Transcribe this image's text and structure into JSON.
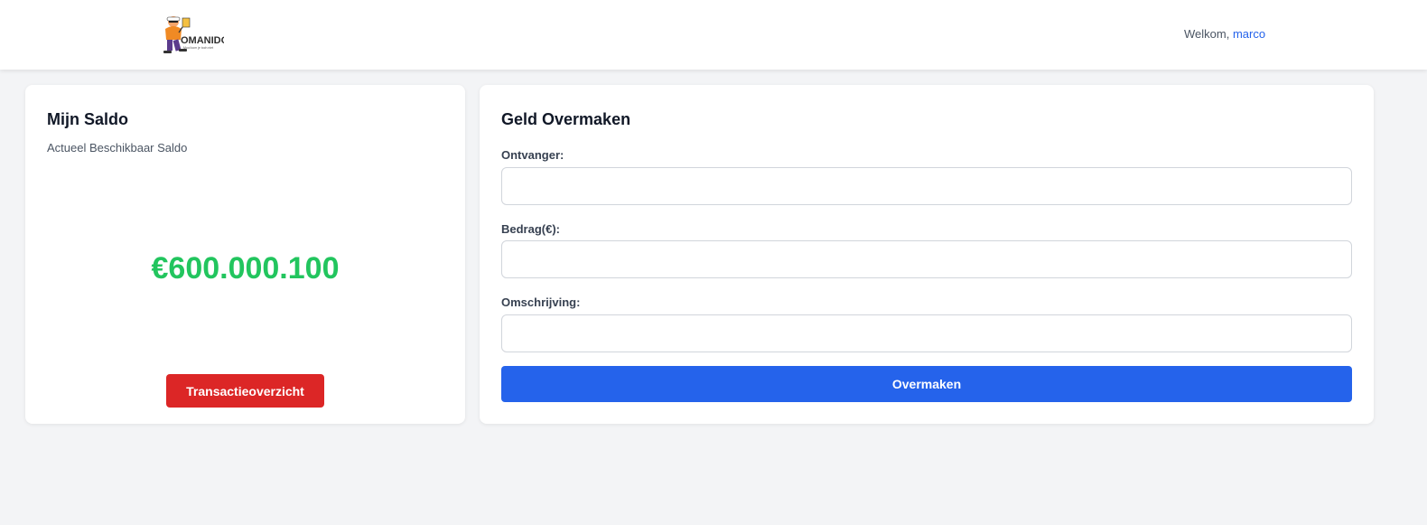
{
  "header": {
    "logo_text": "OMANIDO",
    "logo_tagline": "Mooi kom je toch niet",
    "welcome_text": "Welkom, ",
    "username": "marco"
  },
  "balance_card": {
    "title": "Mijn Saldo",
    "subtitle": "Actueel Beschikbaar Saldo",
    "amount": "€600.000.100",
    "amount_color": "#22c55e",
    "button_label": "Transactieoverzicht",
    "button_color": "#dc2626"
  },
  "transfer_card": {
    "title": "Geld Overmaken",
    "recipient_label": "Ontvanger:",
    "recipient_value": "",
    "amount_label": "Bedrag(€):",
    "amount_value": "",
    "description_label": "Omschrijving:",
    "description_value": "",
    "submit_label": "Overmaken",
    "submit_color": "#2563eb"
  }
}
